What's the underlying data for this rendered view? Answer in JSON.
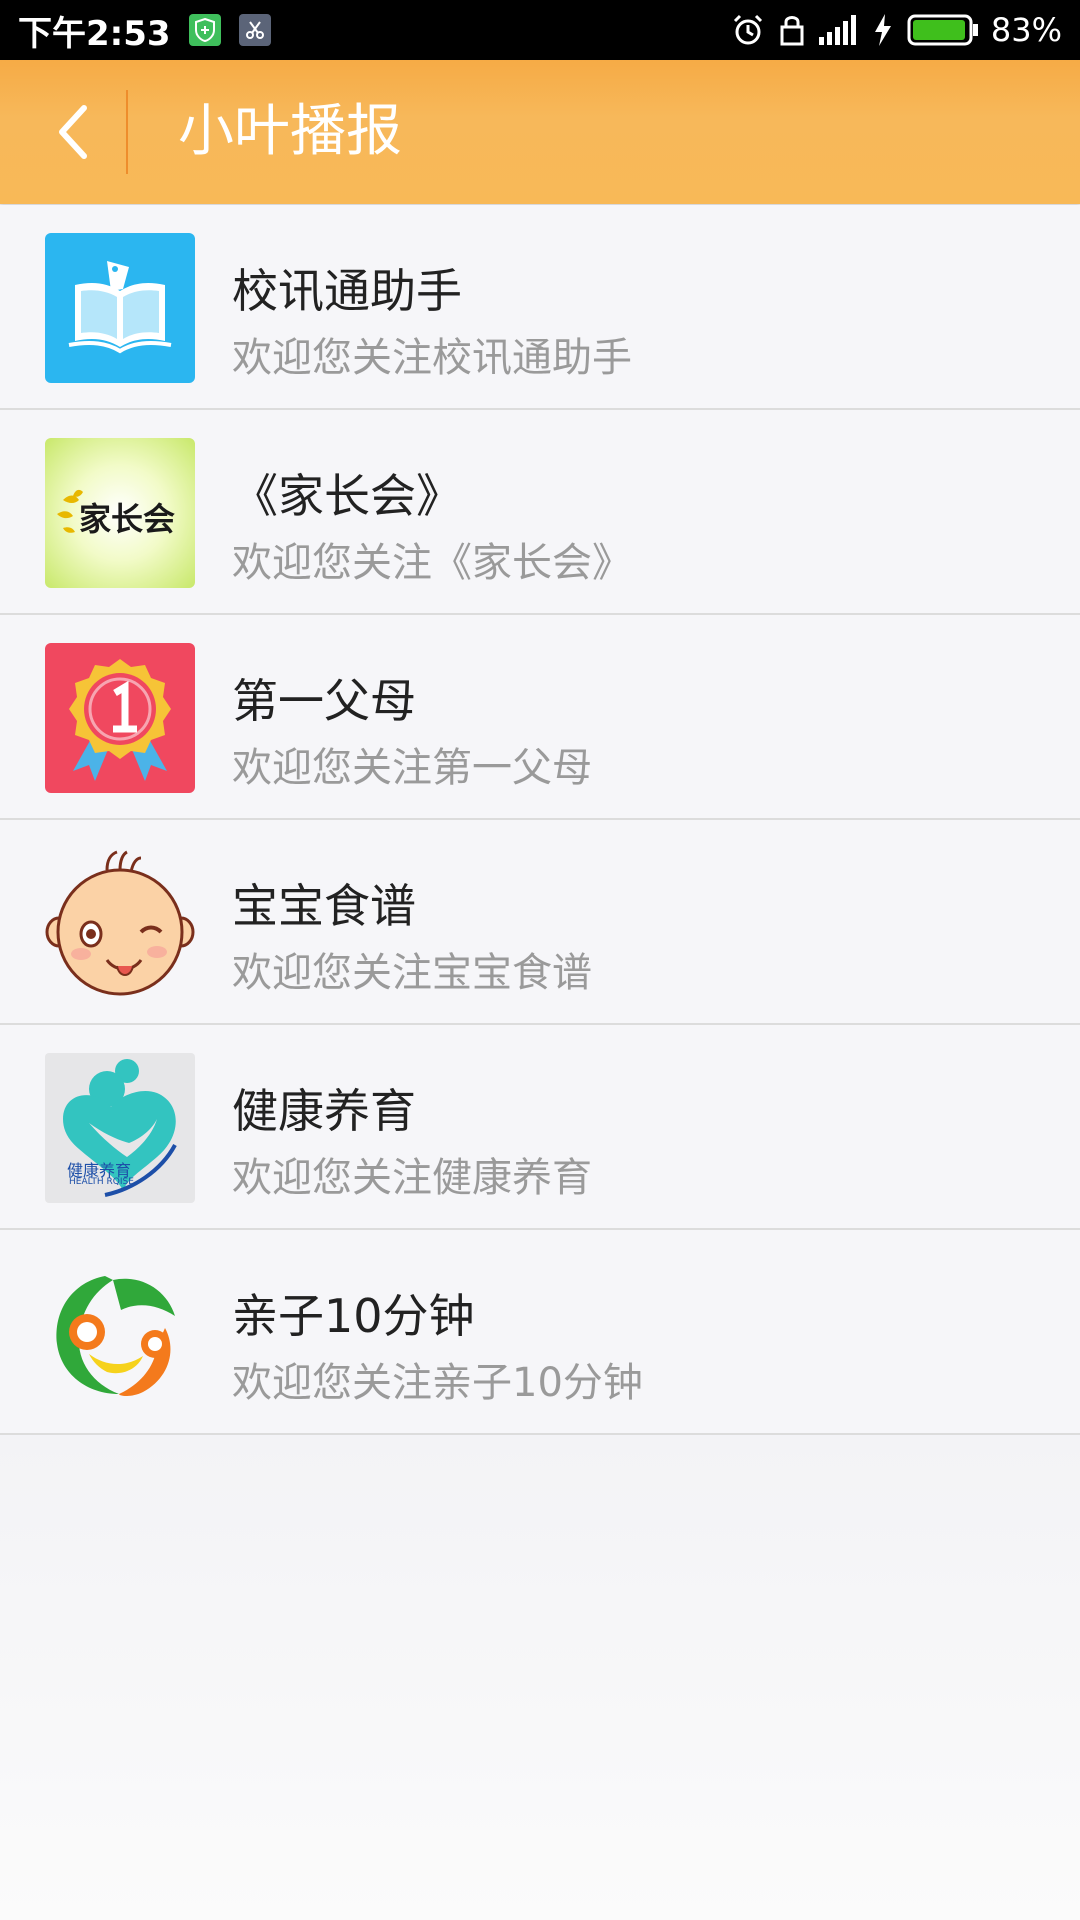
{
  "status_bar": {
    "time": "下午2:53",
    "battery": "83%",
    "accent_green": "#3fbf5c"
  },
  "app_bar": {
    "title": "小叶播报",
    "back_icon": "chevron-left-icon",
    "color": "#f7b554"
  },
  "list": {
    "items": [
      {
        "title": "校讯通助手",
        "subtitle": "欢迎您关注校讯通助手",
        "icon": "open-book-icon",
        "icon_color": "#2bb6f0"
      },
      {
        "title": "《家长会》",
        "subtitle": "欢迎您关注《家长会》",
        "icon": "jiazhanghui-logo",
        "logo_text": "家长会"
      },
      {
        "title": "第一父母",
        "subtitle": "欢迎您关注第一父母",
        "icon": "medal-icon",
        "icon_color": "#f0485f"
      },
      {
        "title": "宝宝食谱",
        "subtitle": "欢迎您关注宝宝食谱",
        "icon": "baby-face-icon"
      },
      {
        "title": "健康养育",
        "subtitle": "欢迎您关注健康养育",
        "icon": "health-raise-logo",
        "logo_text": "健康养育",
        "logo_subtext": "HEALTH RQISE"
      },
      {
        "title": "亲子10分钟",
        "subtitle": "欢迎您关注亲子10分钟",
        "icon": "parent-child-logo"
      }
    ]
  }
}
